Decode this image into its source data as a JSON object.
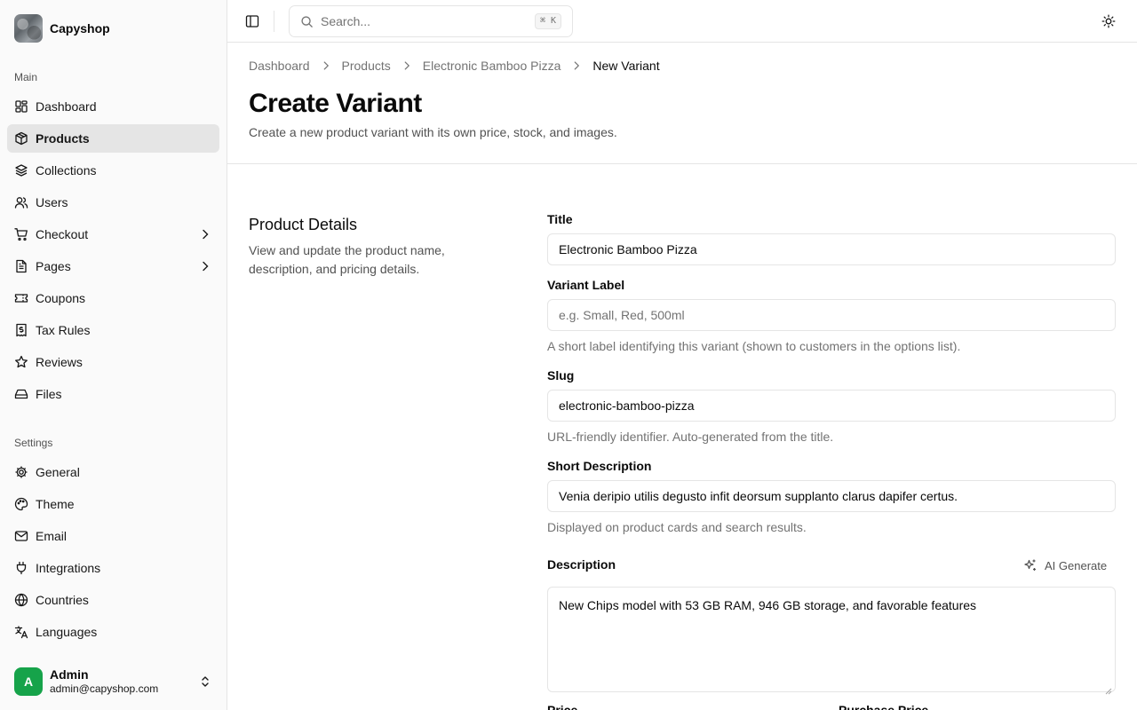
{
  "sidebar": {
    "brand": "Capyshop",
    "main_label": "Main",
    "main_items": [
      {
        "label": "Dashboard",
        "icon": "dashboard-icon"
      },
      {
        "label": "Products",
        "icon": "package-icon",
        "active": true
      },
      {
        "label": "Collections",
        "icon": "layers-icon"
      },
      {
        "label": "Users",
        "icon": "users-icon"
      },
      {
        "label": "Checkout",
        "icon": "cart-icon",
        "has_submenu": true
      },
      {
        "label": "Pages",
        "icon": "file-text-icon",
        "has_submenu": true
      },
      {
        "label": "Coupons",
        "icon": "ticket-icon"
      },
      {
        "label": "Tax Rules",
        "icon": "receipt-icon"
      },
      {
        "label": "Reviews",
        "icon": "star-icon"
      },
      {
        "label": "Files",
        "icon": "hard-drive-icon"
      }
    ],
    "settings_label": "Settings",
    "settings_items": [
      {
        "label": "General",
        "icon": "gear-icon"
      },
      {
        "label": "Theme",
        "icon": "palette-icon"
      },
      {
        "label": "Email",
        "icon": "mail-icon"
      },
      {
        "label": "Integrations",
        "icon": "plug-icon"
      },
      {
        "label": "Countries",
        "icon": "globe-icon"
      },
      {
        "label": "Languages",
        "icon": "languages-icon"
      }
    ],
    "user": {
      "initial": "A",
      "name": "Admin",
      "email": "admin@capyshop.com"
    }
  },
  "topbar": {
    "search_placeholder": "Search...",
    "shortcut": "⌘ K"
  },
  "breadcrumb": [
    "Dashboard",
    "Products",
    "Electronic Bamboo Pizza",
    "New Variant"
  ],
  "page": {
    "title": "Create Variant",
    "description": "Create a new product variant with its own price, stock, and images."
  },
  "section": {
    "title": "Product Details",
    "description": "View and update the product name, description, and pricing details."
  },
  "form": {
    "title_label": "Title",
    "title_value": "Electronic Bamboo Pizza",
    "variant_label_label": "Variant Label",
    "variant_label_placeholder": "e.g. Small, Red, 500ml",
    "variant_label_help": "A short label identifying this variant (shown to customers in the options list).",
    "slug_label": "Slug",
    "slug_value": "electronic-bamboo-pizza",
    "slug_help": "URL-friendly identifier. Auto-generated from the title.",
    "short_desc_label": "Short Description",
    "short_desc_value": "Venia deripio utilis degusto infit deorsum supplanto clarus dapifer certus.",
    "short_desc_help": "Displayed on product cards and search results.",
    "description_label": "Description",
    "ai_generate_label": "AI Generate",
    "description_value": "New Chips model with 53 GB RAM, 946 GB storage, and favorable features",
    "price_label": "Price",
    "purchase_price_label": "Purchase Price"
  },
  "colors": {
    "accent_avatar": "#16a34a",
    "sidebar_bg": "#fafafa",
    "active_bg": "#e5e5e5"
  }
}
